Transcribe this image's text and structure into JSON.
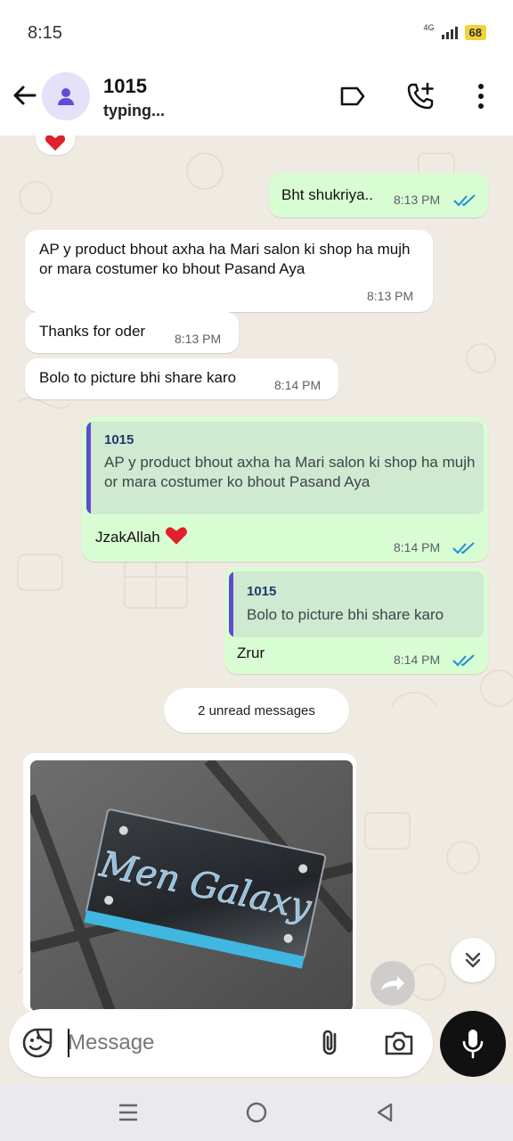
{
  "status_bar": {
    "time": "8:15",
    "network": "4G",
    "battery": "68"
  },
  "header": {
    "contact_name": "1015",
    "contact_status": "typing..."
  },
  "messages": [
    {
      "text": "Bht shukriya..",
      "time": "8:13 PM"
    },
    {
      "text": "AP y product bhout axha ha Mari salon ki shop ha mujh or mara costumer ko bhout Pasand Aya",
      "time": "8:13 PM"
    },
    {
      "text": "Thanks for oder",
      "time": "8:13 PM"
    },
    {
      "text": "Bolo to picture bhi share karo",
      "time": "8:14 PM"
    },
    {
      "quote_author": "1015",
      "quote_text": "AP y product bhout axha ha Mari salon ki shop ha mujh or mara costumer ko bhout Pasand Aya",
      "text": "JzakAllah",
      "emoji": "❤️",
      "time": "8:14 PM"
    },
    {
      "quote_author": "1015",
      "quote_text": "Bolo to picture bhi share karo",
      "text": "Zrur",
      "time": "8:14 PM"
    }
  ],
  "unread_divider": "2 unread messages",
  "photo": {
    "sign_text": "Men Galaxy"
  },
  "composer": {
    "placeholder": "Message"
  },
  "colors": {
    "out_bubble": "#d9fdd3",
    "in_bubble": "#ffffff",
    "chat_bg": "#efeae2",
    "read_ticks": "#1f8fd8",
    "quote_bar": "#5e4ccd"
  }
}
